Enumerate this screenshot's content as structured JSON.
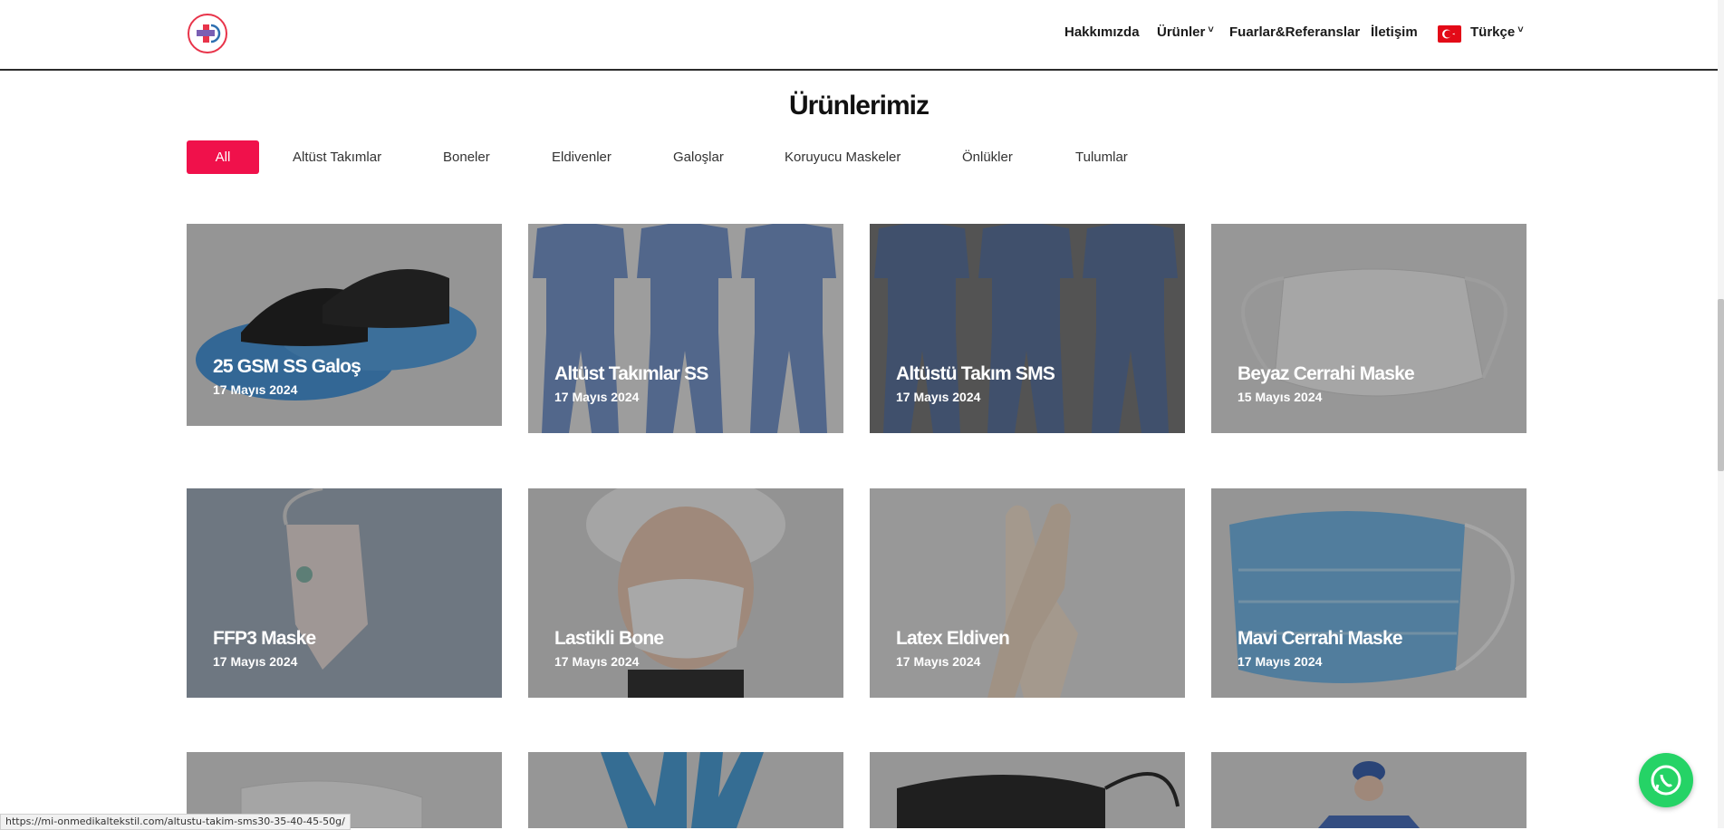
{
  "header": {
    "nav": {
      "about": "Hakkımızda",
      "products": "Ürünler",
      "fairs": "Fuarlar&Referanslar",
      "contact": "İletişim",
      "language": "Türkçe"
    }
  },
  "page": {
    "title": "Ürünlerimiz"
  },
  "filters": [
    "All",
    "Altüst Takımlar",
    "Boneler",
    "Eldivenler",
    "Galoşlar",
    "Koruyucu Maskeler",
    "Önlükler",
    "Tulumlar"
  ],
  "products": [
    {
      "title": "25 GSM SS Galoş",
      "date": "17 Mayıs 2024"
    },
    {
      "title": "Altüst Takımlar SS",
      "date": "17 Mayıs 2024"
    },
    {
      "title": "Altüstü Takım SMS",
      "date": "17 Mayıs 2024"
    },
    {
      "title": "Beyaz Cerrahi Maske",
      "date": "15 Mayıs 2024"
    },
    {
      "title": "FFP3 Maske",
      "date": "17 Mayıs 2024"
    },
    {
      "title": "Lastikli Bone",
      "date": "17 Mayıs 2024"
    },
    {
      "title": "Latex Eldiven",
      "date": "17 Mayıs 2024"
    },
    {
      "title": "Mavi Cerrahi Maske",
      "date": "17 Mayıs 2024"
    }
  ],
  "status_bar": {
    "url": "https://mi-onmedikaltekstil.com/altustu-takim-sms30-35-40-45-50g/"
  },
  "colors": {
    "accent": "#f0114b",
    "whatsapp": "#25d366"
  }
}
